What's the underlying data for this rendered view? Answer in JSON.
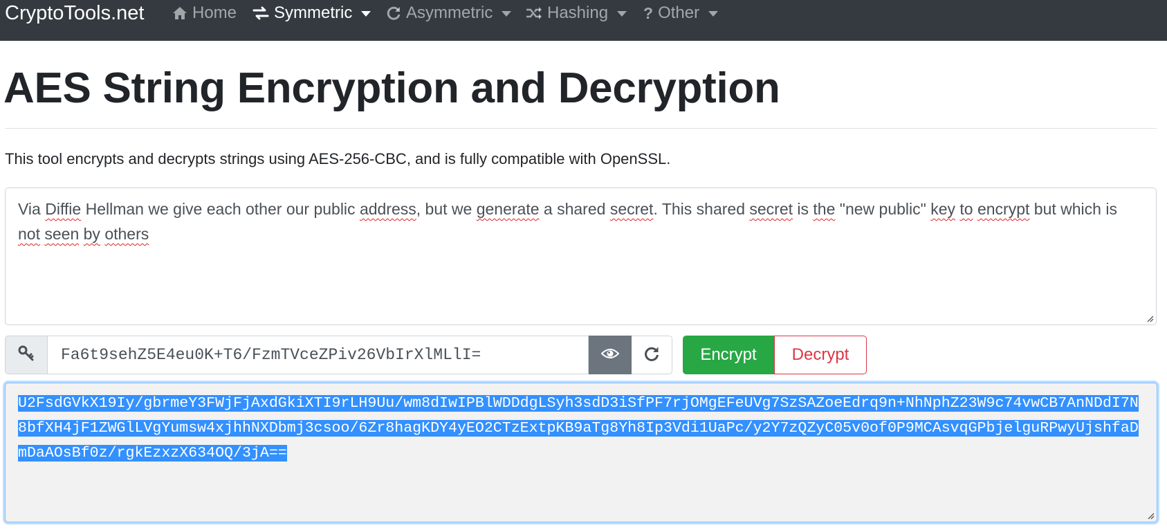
{
  "navbar": {
    "brand": "CryptoTools.net",
    "items": [
      {
        "label": "Home",
        "icon": "home-icon",
        "dropdown": false,
        "active": false
      },
      {
        "label": "Symmetric",
        "icon": "exchange-icon",
        "dropdown": true,
        "active": true
      },
      {
        "label": "Asymmetric",
        "icon": "refresh-icon",
        "dropdown": true,
        "active": false
      },
      {
        "label": "Hashing",
        "icon": "random-icon",
        "dropdown": true,
        "active": false
      },
      {
        "label": "Other",
        "icon": "question-icon",
        "dropdown": true,
        "active": false
      }
    ]
  },
  "page": {
    "title": "AES String Encryption and Decryption",
    "description": "This tool encrypts and decrypts strings using AES-256-CBC, and is fully compatible with OpenSSL."
  },
  "plaintext": {
    "value": "Via Diffie Hellman we give each other our public address, but we generate a shared secret. This shared secret is the \"new public\" key to encrypt but which is not seen by others"
  },
  "key": {
    "value": "Fa6t9sehZ5E4eu0K+T6/FzmTVceZPiv26VbIrXlMLlI=",
    "prepend_icon": "key-icon",
    "toggle_icon": "eye-icon",
    "regenerate_icon": "refresh-icon"
  },
  "actions": {
    "encrypt_label": "Encrypt",
    "decrypt_label": "Decrypt"
  },
  "ciphertext": {
    "value": "U2FsdGVkX19Iy/gbrmeY3FWjFjAxdGkiXTI9rLH9Uu/wm8dIwIPBlWDDdgLSyh3sdD3iSfPF7rjOMgEFeUVg7SzSAZoeEdrq9n+NhNphZ23W9c74vwCB7AnNDdI7N8bfXH4jF1ZWGlLVgYumsw4xjhhNXDbmj3csoo/6Zr8hagKDY4yEO2CTzExtpKB9aTg8Yh8Ip3Vdi1UaPc/y2Y7zQZyC05v0of0P9MCAsvqGPbjelguRPwyUjshfaDmDaAOsBf0z/rgkEzxzX634OQ/3jA==",
    "selected": true
  },
  "colors": {
    "navbar_bg": "#343a40",
    "encrypt_green": "#28a745",
    "decrypt_red": "#dc3545",
    "selection_blue": "#3390ff",
    "focus_border": "#80bdff"
  }
}
